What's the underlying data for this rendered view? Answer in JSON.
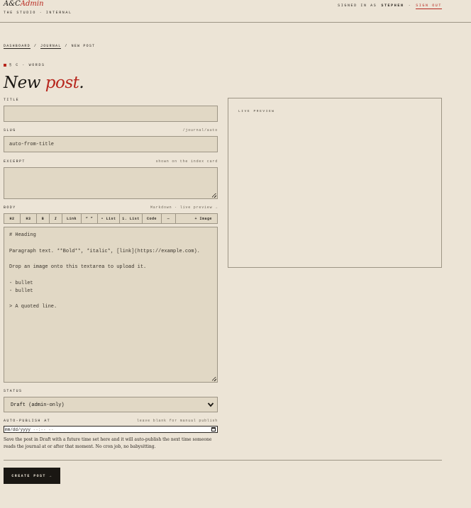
{
  "brand": {
    "name_prefix": "A&C",
    "name_accent": "Admin",
    "subtitle": "The Studio · Internal"
  },
  "userbar": {
    "signed_in_label": "Signed in as",
    "user": "stephen",
    "separator": "·",
    "sign_out": "Sign out"
  },
  "breadcrumb": {
    "items": [
      "Dashboard",
      "Journal",
      "New post"
    ],
    "separator": "/"
  },
  "eyebrow": "§ C · Words",
  "page_title": {
    "main": "New",
    "accent": "post",
    "punct": "."
  },
  "form": {
    "title": {
      "label": "Title",
      "value": ""
    },
    "slug": {
      "label": "Slug",
      "hint": "/journal/auto",
      "value": "auto-from-title"
    },
    "excerpt": {
      "label": "Excerpt",
      "hint": "shown on the index card",
      "value": ""
    },
    "body": {
      "label": "Body",
      "hint": "Markdown · live preview →",
      "toolbar": [
        "H2",
        "H3",
        "B",
        "I",
        "Link",
        "“ ”",
        "• List",
        "1. List",
        "Code",
        "—",
        "+ Image"
      ],
      "lines": [
        "# Heading",
        "",
        "Paragraph text. **Bold**, *italic*, [link](https://example.com).",
        "",
        "Drop an image onto this textarea to upload it.",
        "",
        "- bullet",
        "- bullet",
        "",
        "> A quoted line."
      ]
    },
    "status": {
      "label": "Status",
      "value": "Draft (admin-only)"
    },
    "auto_publish": {
      "label": "Auto-publish at",
      "hint": "leave blank for manual publish",
      "value": "mm/dd/yyyy",
      "time_placeholder": "--:-- --",
      "help": "Save the post in Draft with a future time set here and it will auto-publish the next time someone reads the journal at or after that moment. No cron job, no babysitting."
    },
    "submit": "Create post →"
  },
  "preview": {
    "label": "Live preview"
  },
  "colors": {
    "background": "#ece4d6",
    "accent": "#b7261d",
    "field": "#e1d8c5",
    "ink": "#1a1713"
  }
}
